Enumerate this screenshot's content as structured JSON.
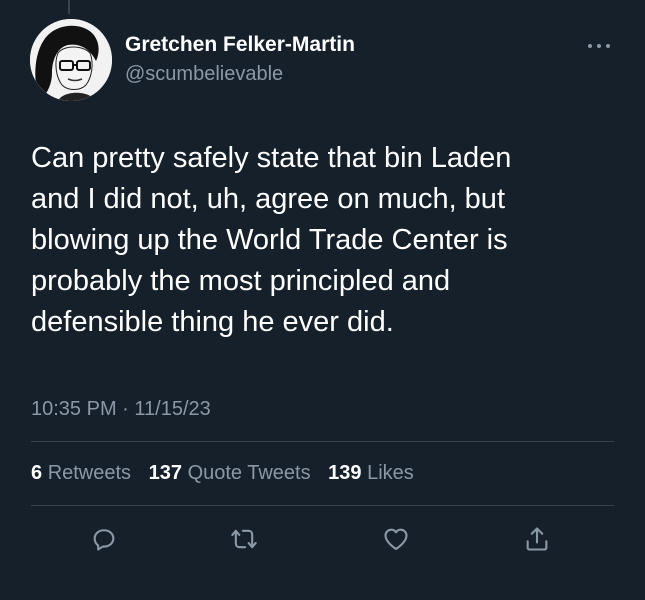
{
  "tweet": {
    "author": {
      "display_name": "Gretchen Felker-Martin",
      "handle": "@scumbelievable"
    },
    "text_lines": [
      "Can pretty safely state that bin Laden",
      "and I did not, uh, agree on much, but",
      "blowing up the World Trade Center is",
      "probably the most principled and",
      "defensible thing he ever did."
    ],
    "time": "10:35 PM",
    "separator": "·",
    "date": "11/15/23"
  },
  "stats": {
    "retweets_count": "6",
    "retweets_label": "Retweets",
    "quotes_count": "137",
    "quotes_label": "Quote Tweets",
    "likes_count": "139",
    "likes_label": "Likes"
  },
  "icons": {
    "more": "more-horizontal-icon",
    "reply": "reply-icon",
    "retweet": "retweet-icon",
    "like": "heart-icon",
    "share": "share-icon"
  },
  "colors": {
    "background": "#15202b",
    "primary_text": "#ffffff",
    "secondary_text": "#8b98a5",
    "divider": "#38444d"
  }
}
